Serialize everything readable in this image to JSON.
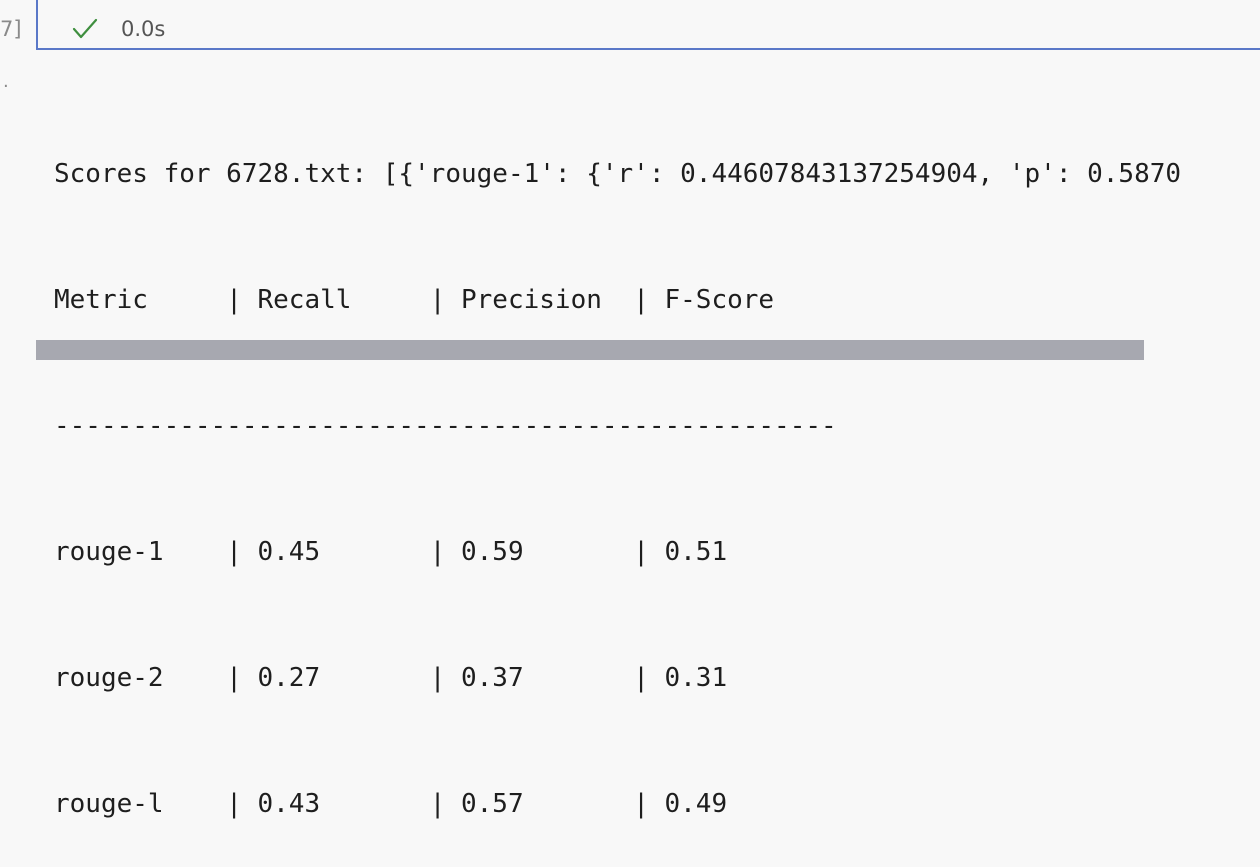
{
  "cell": {
    "exec_count": "7]",
    "duration": "0.0s",
    "status_icon": "check-icon",
    "output_marker": "·"
  },
  "output": {
    "scores_line": "Scores for 6728.txt: [{'rouge-1': {'r': 0.44607843137254904, 'p': 0.5870",
    "header": [
      "Metric     ",
      "| Recall     ",
      "| Precision  ",
      "| F-Score"
    ],
    "separator": "--------------------------------------------------",
    "rows": [
      [
        "rouge-1    ",
        "| 0.45       ",
        "| 0.59       ",
        "| 0.51"
      ],
      [
        "rouge-2    ",
        "| 0.27       ",
        "| 0.37       ",
        "| 0.31"
      ],
      [
        "rouge-l    ",
        "| 0.43       ",
        "| 0.57       ",
        "| 0.49"
      ]
    ]
  },
  "colors": {
    "check": "#3f8f3f",
    "cell_border": "#5a78c8",
    "scrollbar": "#a7a8b0"
  }
}
